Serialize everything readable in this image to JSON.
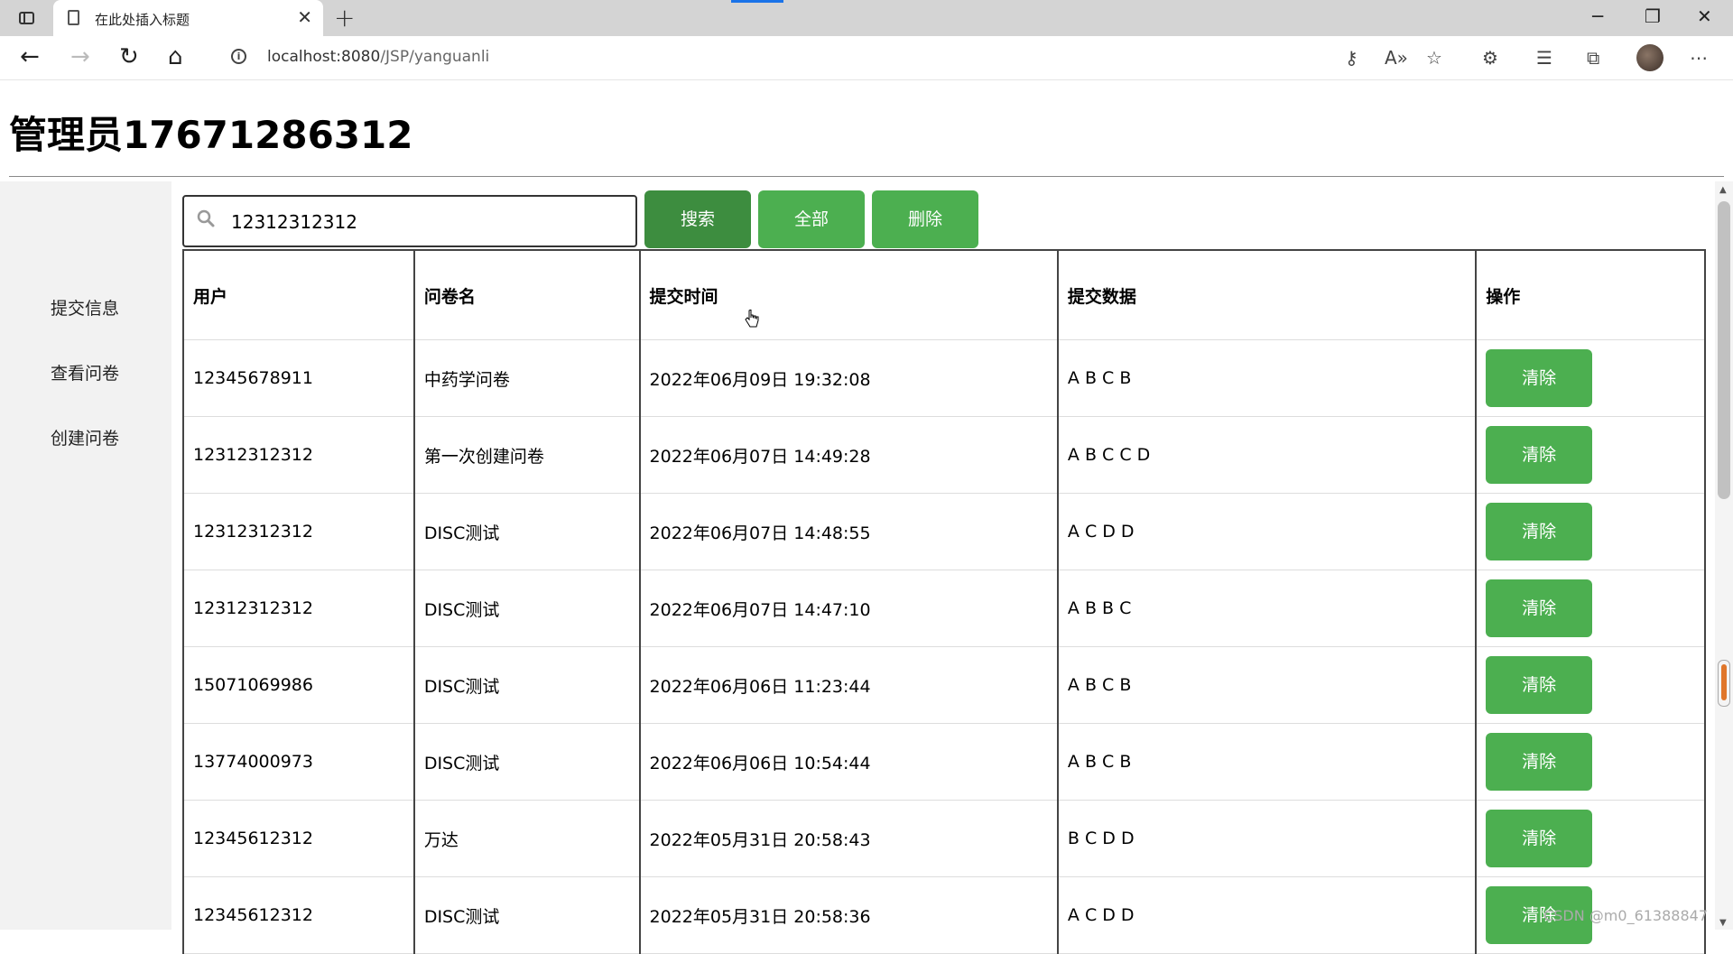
{
  "browser": {
    "tab_title": "在此处插入标题",
    "url_host": "localhost:8080",
    "url_path": "/JSP/yanguanli"
  },
  "page": {
    "heading": "管理员17671286312"
  },
  "sidebar": {
    "items": [
      {
        "label": "提交信息"
      },
      {
        "label": "查看问卷"
      },
      {
        "label": "创建问卷"
      }
    ]
  },
  "search": {
    "value": "12312312312",
    "search_label": "搜索",
    "all_label": "全部",
    "delete_label": "删除"
  },
  "table": {
    "headers": [
      "用户",
      "问卷名",
      "提交时间",
      "提交数据",
      "操作"
    ],
    "rows": [
      {
        "user": "12345678911",
        "survey": "中药学问卷",
        "time": "2022年06月09日 19:32:08",
        "data": "A B C B",
        "action": "清除"
      },
      {
        "user": "12312312312",
        "survey": "第一次创建问卷",
        "time": "2022年06月07日 14:49:28",
        "data": "A B C C D",
        "action": "清除"
      },
      {
        "user": "12312312312",
        "survey": "DISC测试",
        "time": "2022年06月07日 14:48:55",
        "data": "A C D D",
        "action": "清除"
      },
      {
        "user": "12312312312",
        "survey": "DISC测试",
        "time": "2022年06月07日 14:47:10",
        "data": "A B B C",
        "action": "清除"
      },
      {
        "user": "15071069986",
        "survey": "DISC测试",
        "time": "2022年06月06日 11:23:44",
        "data": "A B C B",
        "action": "清除"
      },
      {
        "user": "13774000973",
        "survey": "DISC测试",
        "time": "2022年06月06日 10:54:44",
        "data": "A B C B",
        "action": "清除"
      },
      {
        "user": "12345612312",
        "survey": "万达",
        "time": "2022年05月31日 20:58:43",
        "data": "B C D D",
        "action": "清除"
      },
      {
        "user": "12345612312",
        "survey": "DISC测试",
        "time": "2022年05月31日 20:58:36",
        "data": "A C D D",
        "action": "清除"
      }
    ]
  },
  "watermark": "CSDN @m0_61388847",
  "colors": {
    "button_green": "#4caf50",
    "button_green_active": "#3d8d3f",
    "sidebar_bg": "#f2f2f2"
  }
}
